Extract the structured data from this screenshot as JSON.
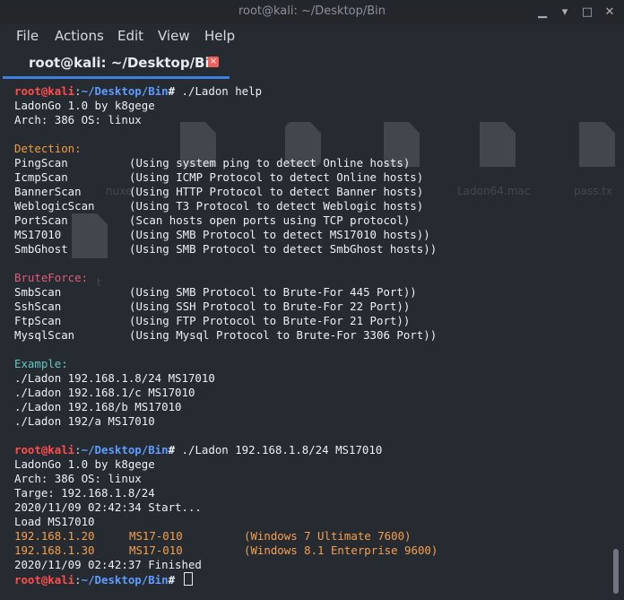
{
  "window": {
    "title": "root@kali: ~/Desktop/Bin",
    "controls": [
      "minimize",
      "maximize",
      "restore",
      "close"
    ]
  },
  "menu": {
    "items": [
      "File",
      "Actions",
      "Edit",
      "View",
      "Help"
    ]
  },
  "tab": {
    "label": "root@kali: ~/Desktop/Bin",
    "close_symbol": "×"
  },
  "prompt": {
    "user": "root@kali",
    "colon": ":",
    "path": "~/Desktop/Bin",
    "hash": "#"
  },
  "background_icons": [
    {
      "label": "nuxe"
    },
    {
      "label": "Ladon64.mac"
    },
    {
      "label": "pass.tx"
    },
    {
      "label": "t"
    }
  ],
  "terminal": {
    "lines": [
      {
        "type": "prompt",
        "command": " ./Ladon help"
      },
      {
        "type": "text",
        "text": "LadonGo 1.0 by k8gege"
      },
      {
        "type": "text",
        "text": "Arch: 386 OS: linux"
      },
      {
        "type": "blank"
      },
      {
        "type": "section",
        "text": "Detection:",
        "color": "orange"
      },
      {
        "type": "pair",
        "name": "PingScan",
        "desc": "(Using system ping to detect Online hosts)"
      },
      {
        "type": "pair",
        "name": "IcmpScan",
        "desc": "(Using ICMP Protocol to detect Online hosts)"
      },
      {
        "type": "pair",
        "name": "BannerScan",
        "desc": "(Using HTTP Protocol to detect Banner hosts)"
      },
      {
        "type": "pair",
        "name": "WeblogicScan",
        "desc": "(Using T3 Protocol to detect Weblogic hosts)"
      },
      {
        "type": "pair",
        "name": "PortScan",
        "desc": "(Scan hosts open ports using TCP protocol)"
      },
      {
        "type": "pair",
        "name": "MS17010",
        "desc": "(Using SMB Protocol to detect MS17010 hosts))"
      },
      {
        "type": "pair",
        "name": "SmbGhost",
        "desc": "(Using SMB Protocol to detect SmbGhost hosts))"
      },
      {
        "type": "blank"
      },
      {
        "type": "section",
        "text": "BruteForce:",
        "color": "red"
      },
      {
        "type": "pair",
        "name": "SmbScan",
        "desc": "(Using SMB Protocol to Brute-For 445 Port))"
      },
      {
        "type": "pair",
        "name": "SshScan",
        "desc": "(Using SSH Protocol to Brute-For 22 Port))"
      },
      {
        "type": "pair",
        "name": "FtpScan",
        "desc": "(Using FTP Protocol to Brute-For 21 Port))"
      },
      {
        "type": "pair",
        "name": "MysqlScan",
        "desc": "(Using Mysql Protocol to Brute-For 3306 Port))"
      },
      {
        "type": "blank"
      },
      {
        "type": "section",
        "text": "Example:",
        "color": "teal"
      },
      {
        "type": "text",
        "text": "./Ladon 192.168.1.8/24 MS17010"
      },
      {
        "type": "text",
        "text": "./Ladon 192.168.1/c MS17010"
      },
      {
        "type": "text",
        "text": "./Ladon 192.168/b MS17010"
      },
      {
        "type": "text",
        "text": "./Ladon 192/a MS17010"
      },
      {
        "type": "blank"
      },
      {
        "type": "prompt",
        "command": " ./Ladon 192.168.1.8/24 MS17010"
      },
      {
        "type": "text",
        "text": "LadonGo 1.0 by k8gege"
      },
      {
        "type": "text",
        "text": "Arch: 386 OS: linux"
      },
      {
        "type": "text",
        "text": "Targe: 192.168.1.8/24"
      },
      {
        "type": "text",
        "text": "2020/11/09 02:42:34 Start..."
      },
      {
        "type": "text",
        "text": "Load MS17010"
      },
      {
        "type": "result",
        "ip": "192.168.1.20",
        "vuln": "MS17-010",
        "os": "(Windows 7 Ultimate 7600)"
      },
      {
        "type": "result",
        "ip": "192.168.1.30",
        "vuln": "MS17-010",
        "os": "(Windows 8.1 Enterprise 9600)"
      },
      {
        "type": "text",
        "text": "2020/11/09 02:42:37 Finished"
      },
      {
        "type": "prompt",
        "command": " ",
        "cursor": true
      }
    ]
  }
}
